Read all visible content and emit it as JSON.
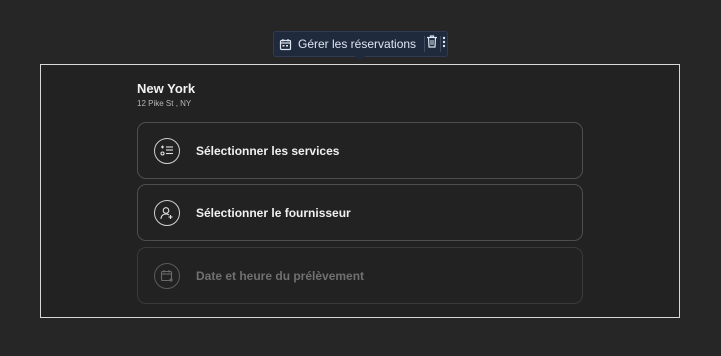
{
  "toolbar": {
    "label": "Gérer les réservations",
    "icons": {
      "main": "calendar-icon",
      "delete": "trash-icon",
      "more": "more-vertical-icon"
    }
  },
  "location": {
    "name": "New York",
    "address": "12 Pike St , NY"
  },
  "steps": [
    {
      "label": "Sélectionner les services",
      "icon": "service-list-icon",
      "enabled": true
    },
    {
      "label": "Sélectionner le fournisseur",
      "icon": "user-add-icon",
      "enabled": true
    },
    {
      "label": "Date et heure du prélèvement",
      "icon": "calendar-add-icon",
      "enabled": false
    }
  ],
  "colors": {
    "background": "#262626",
    "toolbar": "#1f2a3d",
    "frame_border": "#d8d8d8",
    "card_border": "#4e4e4e",
    "disabled_text": "#707070"
  }
}
